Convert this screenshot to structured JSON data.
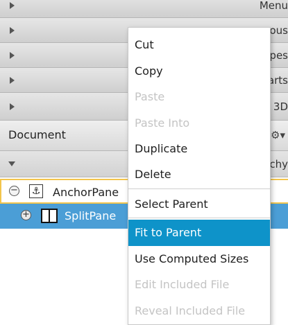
{
  "library_panels": [
    {
      "label": "Menu"
    },
    {
      "label": "eous"
    },
    {
      "label": "apes"
    },
    {
      "label": "harts"
    },
    {
      "label": "3D"
    }
  ],
  "document": {
    "title": "Document",
    "gear_glyph": "⚙▾",
    "hierarchy_label": "rchy"
  },
  "hierarchy": {
    "items": [
      {
        "label": "AnchorPane",
        "toggle": "−",
        "icon": "anchor-pane-icon"
      },
      {
        "label": "SplitPane",
        "toggle": "+",
        "icon": "split-pane-icon"
      }
    ]
  },
  "context_menu": {
    "cut": "Cut",
    "copy": "Copy",
    "paste": "Paste",
    "paste_into": "Paste Into",
    "duplicate": "Duplicate",
    "delete": "Delete",
    "select_parent": "Select Parent",
    "fit_to_parent": "Fit to Parent",
    "use_computed_sizes": "Use Computed Sizes",
    "edit_included_file": "Edit Included File",
    "reveal_included_file": "Reveal Included File"
  },
  "colors": {
    "selection": "#0e93c9",
    "tree_selection": "#4b9ed6",
    "focus_border": "#f3c54c"
  }
}
